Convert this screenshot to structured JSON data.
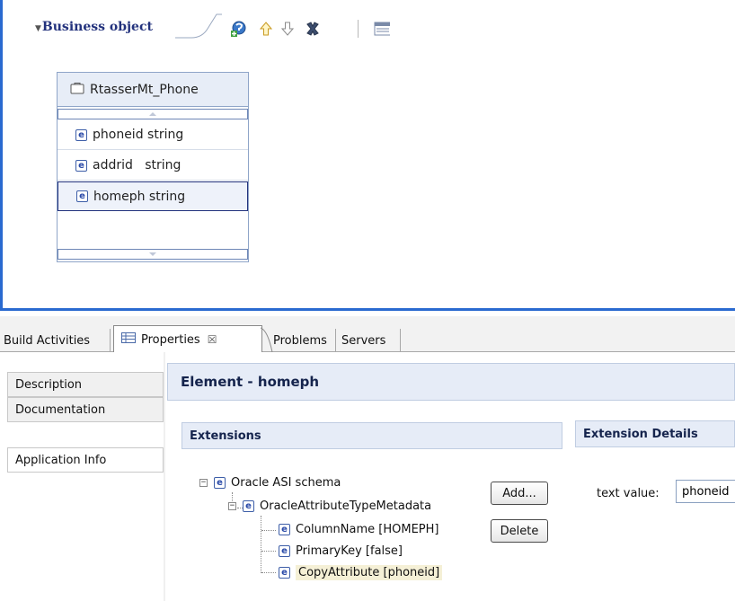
{
  "editor": {
    "section_title": "Business object",
    "toolbar": [
      "add-attribute-icon",
      "move-up-icon",
      "move-down-icon",
      "delete-icon",
      "properties-icon"
    ],
    "business_object": {
      "name": "RtasserMt_Phone",
      "fields": [
        {
          "name": "phoneid",
          "type": "string"
        },
        {
          "name": "addrid",
          "type": "string"
        },
        {
          "name": "homeph",
          "type": "string"
        }
      ],
      "selected_index": 2
    }
  },
  "tabs": {
    "build_activities": "Build Activities",
    "properties": "Properties",
    "properties_close": "☒",
    "problems": "Problems",
    "servers": "Servers"
  },
  "properties": {
    "nav": [
      "Description",
      "Documentation",
      "Application Info"
    ],
    "active_nav": "Application Info",
    "element_title": "Element - homeph",
    "extensions_title": "Extensions",
    "extension_details_title": "Extension Details",
    "tree": {
      "root": "Oracle ASI schema",
      "child": "OracleAttributeTypeMetadata",
      "leaves": [
        "ColumnName [HOMEPH]",
        "PrimaryKey [false]",
        "CopyAttribute [phoneid]"
      ],
      "twisty_collapsed_sign": "⊟",
      "element_icon_letter": "e"
    },
    "add_button": "Add...",
    "delete_button": "Delete",
    "text_value_label": "text value:",
    "text_value": "phoneid"
  },
  "colors": {
    "accent_blue": "#2a6ad0",
    "header_bg": "#e6ecf7",
    "title_navy": "#23327d"
  }
}
